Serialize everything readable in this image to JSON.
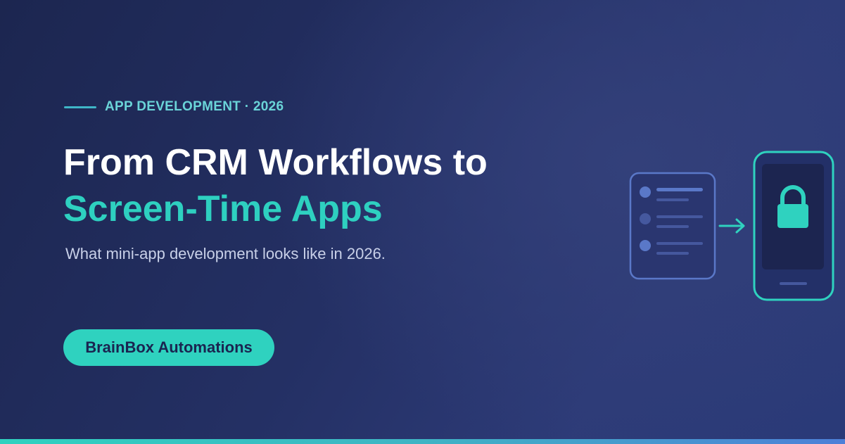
{
  "eyebrow": {
    "text": "APP DEVELOPMENT · 2026"
  },
  "headline": {
    "line1": "From CRM Workflows to",
    "line2": "Screen-Time Apps"
  },
  "subtitle": "What mini-app development looks like in 2026.",
  "cta": {
    "label": "BrainBox Automations"
  },
  "colors": {
    "background": "#243064",
    "accent_teal": "#2ed0c0",
    "eyebrow_teal": "#6ad4d8",
    "subtitle": "#c8d0e8",
    "list_card_border": "#5a78c8",
    "phone_border": "#2fd2bf",
    "cta_text": "#1a2450"
  },
  "illustration": {
    "list_card_icon": "checklist-card-icon",
    "arrow_icon": "arrow-right-icon",
    "phone_icon": "phone-icon",
    "lock_icon": "lock-icon"
  }
}
